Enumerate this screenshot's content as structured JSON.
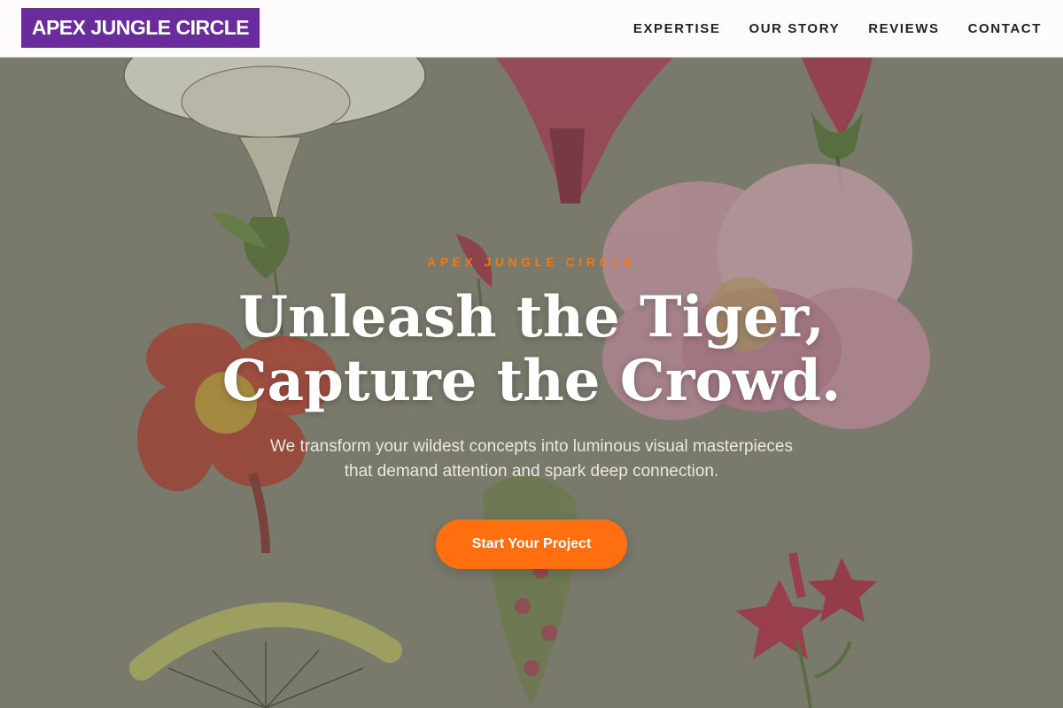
{
  "header": {
    "logo": "APEX JUNGLE CIRCLE",
    "nav": [
      {
        "label": "EXPERTISE"
      },
      {
        "label": "OUR STORY"
      },
      {
        "label": "REVIEWS"
      },
      {
        "label": "CONTACT"
      }
    ]
  },
  "hero": {
    "eyebrow": "APEX JUNGLE CIRCLE",
    "headline_line1": "Unleash the Tiger,",
    "headline_line2": "Capture the Crowd.",
    "subtext_line1": "We transform your wildest concepts into luminous visual masterpieces",
    "subtext_line2": "that demand attention and spark deep connection.",
    "cta_label": "Start Your Project",
    "background": "botanical flower illustrations"
  },
  "colors": {
    "brand_purple": "#6a2c9c",
    "accent_orange": "#ff6f0f",
    "eyebrow_orange": "#f07a1a",
    "header_bg": "#fdfcfa"
  }
}
